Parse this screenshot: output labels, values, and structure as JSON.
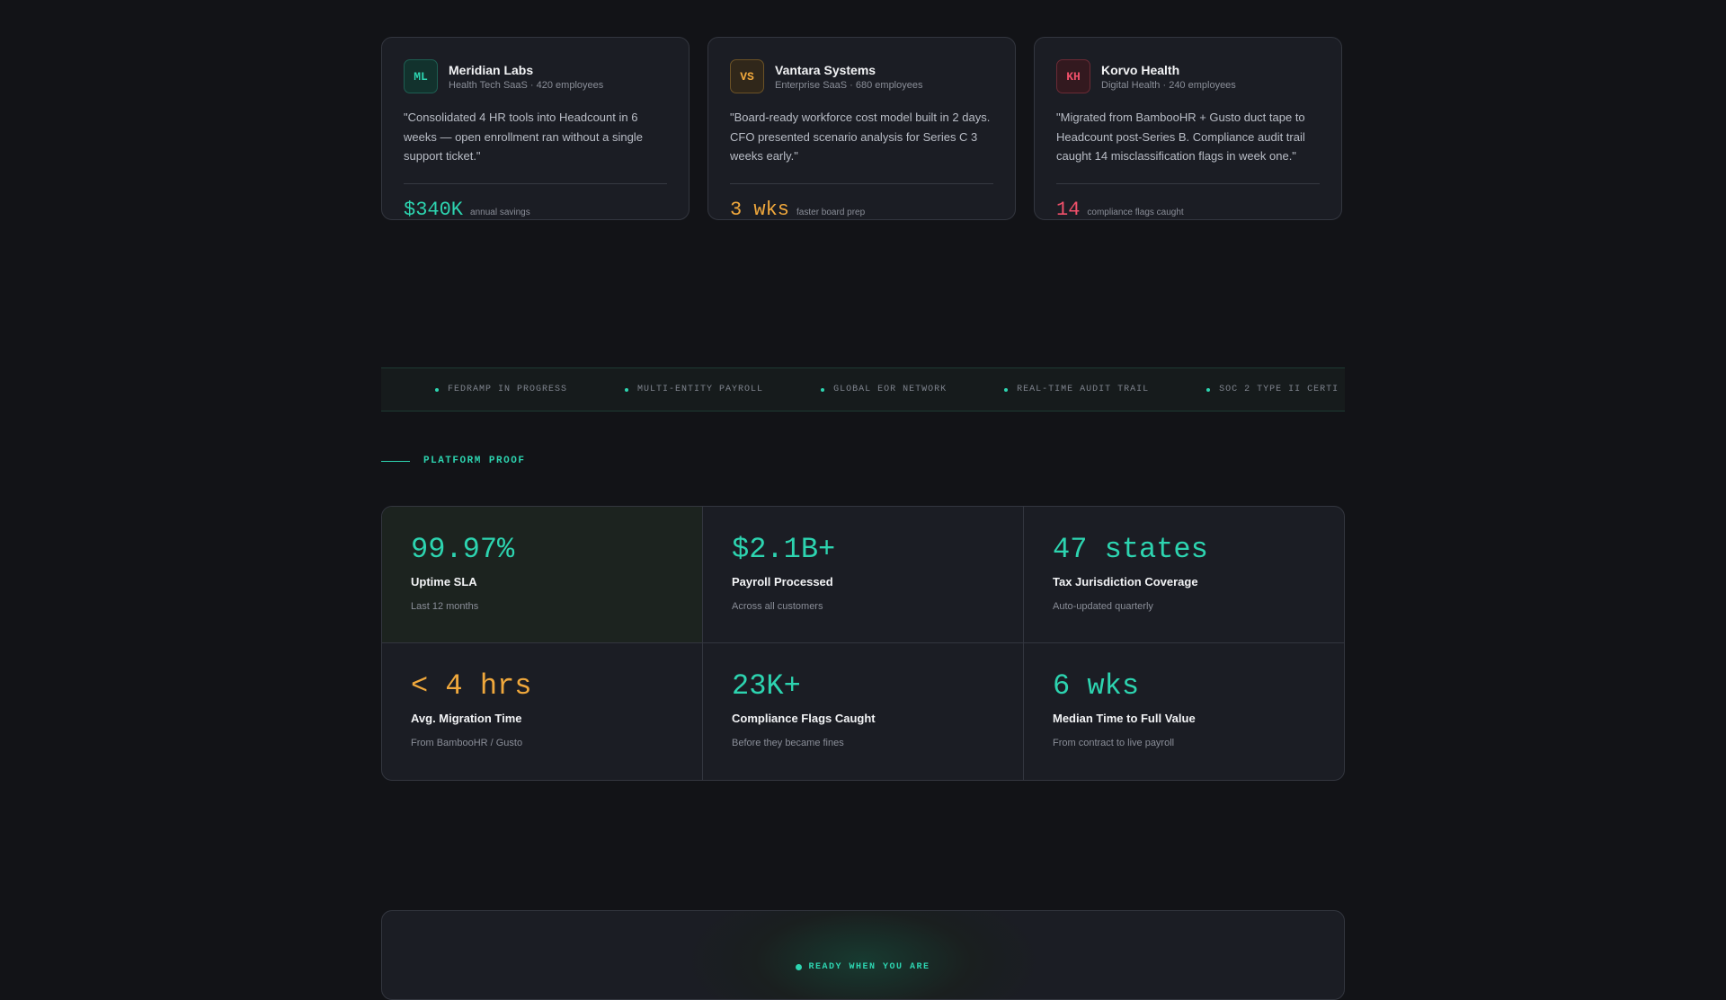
{
  "testimonials": [
    {
      "initials": "ML",
      "accent": "#2dd4b0",
      "company": "Meridian Labs",
      "meta": "Health Tech SaaS · 420 employees",
      "quote": "\"Consolidated 4 HR tools into Headcount in 6 weeks — open enrollment ran without a single support ticket.\"",
      "metric_value": "$340K",
      "metric_label": "annual savings"
    },
    {
      "initials": "VS",
      "accent": "#f0a83c",
      "company": "Vantara Systems",
      "meta": "Enterprise SaaS · 680 employees",
      "quote": "\"Board-ready workforce cost model built in 2 days. CFO presented scenario analysis for Series C 3 weeks early.\"",
      "metric_value": "3 wks",
      "metric_label": "faster board prep"
    },
    {
      "initials": "KH",
      "accent": "#f0506a",
      "company": "Korvo Health",
      "meta": "Digital Health · 240 employees",
      "quote": "\"Migrated from BambooHR + Gusto duct tape to Headcount post-Series B. Compliance audit trail caught 14 misclassification flags in week one.\"",
      "metric_value": "14",
      "metric_label": "compliance flags caught"
    }
  ],
  "ticker": [
    "FEDRAMP IN PROGRESS",
    "MULTI-ENTITY PAYROLL",
    "GLOBAL EOR NETWORK",
    "REAL-TIME AUDIT TRAIL",
    "SOC 2 TYPE II CERTI"
  ],
  "section_eyebrow": "PLATFORM PROOF",
  "stats": [
    {
      "value": "99.97%",
      "label": "Uptime SLA",
      "sub": "Last 12 months"
    },
    {
      "value": "$2.1B+",
      "label": "Payroll Processed",
      "sub": "Across all customers"
    },
    {
      "value": "47 states",
      "label": "Tax Jurisdiction Coverage",
      "sub": "Auto-updated quarterly"
    },
    {
      "value": "< 4 hrs",
      "label": "Avg. Migration Time",
      "sub": "From BambooHR / Gusto"
    },
    {
      "value": "23K+",
      "label": "Compliance Flags Caught",
      "sub": "Before they became fines"
    },
    {
      "value": "6 wks",
      "label": "Median Time to Full Value",
      "sub": "From contract to live payroll"
    }
  ],
  "cta": {
    "eyebrow": "READY WHEN YOU ARE"
  },
  "colors": {
    "accent_teal": "#2dd4b0",
    "accent_amber": "#f0a83c",
    "accent_red": "#f0506a",
    "background": "#121317"
  }
}
